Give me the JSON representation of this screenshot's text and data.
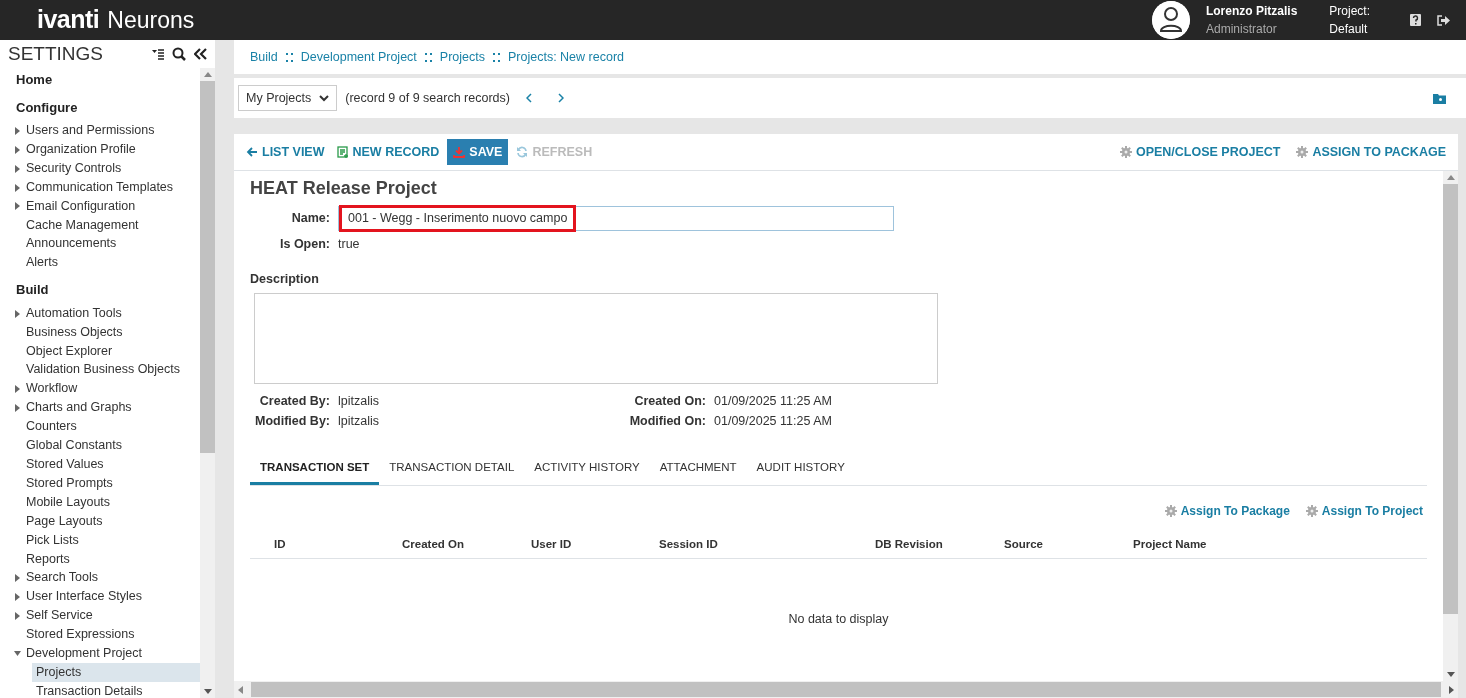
{
  "header": {
    "brand": "ivanti",
    "product": "Neurons",
    "user_name": "Lorenzo Pitzalis",
    "user_role": "Administrator",
    "project_label": "Project:",
    "project_value": "Default"
  },
  "sidebar": {
    "title": "SETTINGS",
    "sections": [
      {
        "title": "Home"
      },
      {
        "title": "Configure",
        "items": [
          {
            "label": "Users and Permissions",
            "expanded": false,
            "selected": false
          },
          {
            "label": "Organization Profile",
            "expanded": false,
            "selected": false
          },
          {
            "label": "Security Controls",
            "expanded": false,
            "selected": false
          },
          {
            "label": "Communication Templates",
            "expanded": false,
            "selected": false
          },
          {
            "label": "Email Configuration",
            "expanded": false,
            "selected": false
          },
          {
            "label": "Cache Management",
            "selected": false
          },
          {
            "label": "Announcements",
            "selected": false
          },
          {
            "label": "Alerts",
            "selected": false
          }
        ]
      },
      {
        "title": "Build",
        "items": [
          {
            "label": "Automation Tools",
            "expanded": false,
            "selected": false
          },
          {
            "label": "Business Objects",
            "selected": false
          },
          {
            "label": "Object Explorer",
            "selected": false
          },
          {
            "label": "Validation Business Objects",
            "selected": false
          },
          {
            "label": "Workflow",
            "expanded": false,
            "selected": false
          },
          {
            "label": "Charts and Graphs",
            "expanded": false,
            "selected": false
          },
          {
            "label": "Counters",
            "selected": false
          },
          {
            "label": "Global Constants",
            "selected": false
          },
          {
            "label": "Stored Values",
            "selected": false
          },
          {
            "label": "Stored Prompts",
            "selected": false
          },
          {
            "label": "Mobile Layouts",
            "selected": false
          },
          {
            "label": "Page Layouts",
            "selected": false
          },
          {
            "label": "Pick Lists",
            "selected": false
          },
          {
            "label": "Reports",
            "selected": false
          },
          {
            "label": "Search Tools",
            "expanded": false,
            "selected": false
          },
          {
            "label": "User Interface Styles",
            "expanded": false,
            "selected": false
          },
          {
            "label": "Self Service",
            "expanded": false,
            "selected": false
          },
          {
            "label": "Stored Expressions",
            "selected": false
          },
          {
            "label": "Development Project",
            "expanded": true,
            "selected": false,
            "children": [
              {
                "label": "Projects",
                "selected": true
              },
              {
                "label": "Transaction Details",
                "selected": false
              }
            ]
          }
        ]
      }
    ]
  },
  "breadcrumb": [
    "Build",
    "Development Project",
    "Projects",
    "Projects: New record"
  ],
  "record_bar": {
    "view": "My Projects",
    "position": "(record 9 of 9 search records)"
  },
  "toolbar": {
    "left": [
      {
        "kind": "back",
        "label": "LIST VIEW",
        "disabled": false
      },
      {
        "kind": "new",
        "label": "NEW RECORD",
        "disabled": false
      },
      {
        "kind": "save",
        "label": "SAVE",
        "disabled": false
      },
      {
        "kind": "refresh",
        "label": "REFRESH",
        "disabled": true
      }
    ],
    "right": [
      {
        "kind": "gear",
        "label": "OPEN/CLOSE PROJECT",
        "disabled": false
      },
      {
        "kind": "gear",
        "label": "ASSIGN TO PACKAGE",
        "disabled": false
      }
    ]
  },
  "form": {
    "title": "HEAT Release Project",
    "name": {
      "label": "Name:",
      "value": "001 - Wegg - Inserimento nuovo campo",
      "highlighted": true
    },
    "is_open": {
      "label": "Is Open:",
      "value": "true"
    },
    "description": {
      "label": "Description"
    },
    "meta": [
      {
        "label": "Created By:",
        "value": "lpitzalis"
      },
      {
        "label": "Created On:",
        "value": "01/09/2025 11:25 AM"
      },
      {
        "label": "Modified By:",
        "value": "lpitzalis"
      },
      {
        "label": "Modified On:",
        "value": "01/09/2025 11:25 AM"
      }
    ]
  },
  "tabs": [
    {
      "label": "TRANSACTION SET",
      "selected": true
    },
    {
      "label": "TRANSACTION DETAIL",
      "selected": false
    },
    {
      "label": "ACTIVITY HISTORY",
      "selected": false
    },
    {
      "label": "ATTACHMENT",
      "selected": false
    },
    {
      "label": "AUDIT HISTORY",
      "selected": false
    }
  ],
  "grid": {
    "actions": [
      "Assign To Package",
      "Assign To Project"
    ],
    "columns": [
      "ID",
      "Created On",
      "User ID",
      "Session ID",
      "DB Revision",
      "Source",
      "Project Name"
    ],
    "empty_text": "No data to display"
  }
}
